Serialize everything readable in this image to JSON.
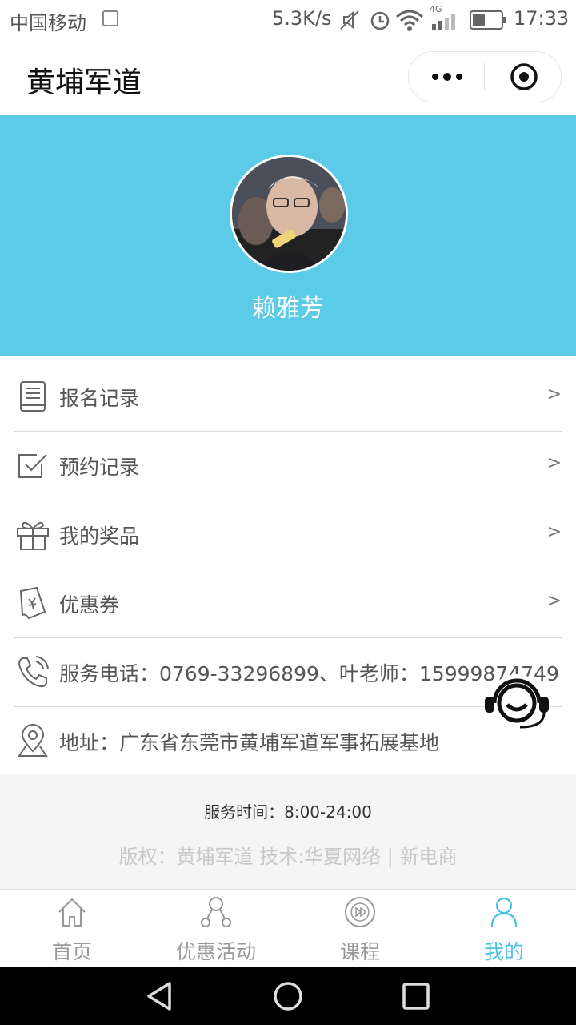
{
  "status_bar": {
    "carrier": "中国移动",
    "speed": "5.3K/s",
    "network": "4G",
    "time": "17:33"
  },
  "title_bar": {
    "title": "黄埔军道"
  },
  "profile": {
    "name": "赖雅芳",
    "header_color": "#5ccbe8"
  },
  "menu": [
    {
      "label": "报名记录",
      "icon": "document-list-icon",
      "arrow": ">"
    },
    {
      "label": "预约记录",
      "icon": "checkbox-icon",
      "arrow": ">"
    },
    {
      "label": "我的奖品",
      "icon": "gift-icon",
      "arrow": ">"
    },
    {
      "label": "优惠券",
      "icon": "coupon-icon",
      "arrow": ">"
    },
    {
      "label": "服务电话：0769-33296899、叶老师：15999874749",
      "icon": "phone-icon"
    },
    {
      "label": "地址：广东省东莞市黄埔军道军事拓展基地",
      "icon": "location-icon"
    }
  ],
  "footer": {
    "service_time": "服务时间：8:00-24:00",
    "copyright": "版权：黄埔军道 技术:华夏网络 | 新电商"
  },
  "tabs": [
    {
      "label": "首页",
      "icon": "home-icon"
    },
    {
      "label": "优惠活动",
      "icon": "share-icon"
    },
    {
      "label": "课程",
      "icon": "play-icon"
    },
    {
      "label": "我的",
      "icon": "user-icon",
      "active": true
    }
  ],
  "accent_color": "#4dc1e1"
}
